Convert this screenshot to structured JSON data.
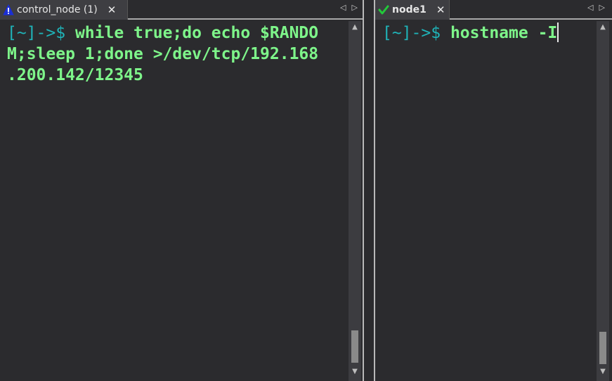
{
  "left_pane": {
    "tab_title": "control_node (1)",
    "tab_close": "✕",
    "tab_status_icon": "warning-icon",
    "nav_prev": "◁",
    "nav_next": "▷",
    "prompt": "[~]->$",
    "command_line1": " while true;do echo $RANDO",
    "command_line2": "M;sleep 1;done >/dev/tcp/192.168",
    "command_line3": ".200.142/12345"
  },
  "right_pane": {
    "tab_title": "node1",
    "tab_close": "✕",
    "tab_status_icon": "checkmark-icon",
    "nav_prev": "◁",
    "nav_next": "▷",
    "prompt": "[~]->$",
    "command": " hostname -I"
  },
  "scrollbar": {
    "up_arrow": "▲",
    "down_arrow": "▼"
  },
  "colors": {
    "background": "#2b2b2e",
    "command_text": "#7ef58a",
    "prompt_text": "#1fb3b8",
    "warning": "#1b2fd6",
    "check": "#22c93a"
  }
}
